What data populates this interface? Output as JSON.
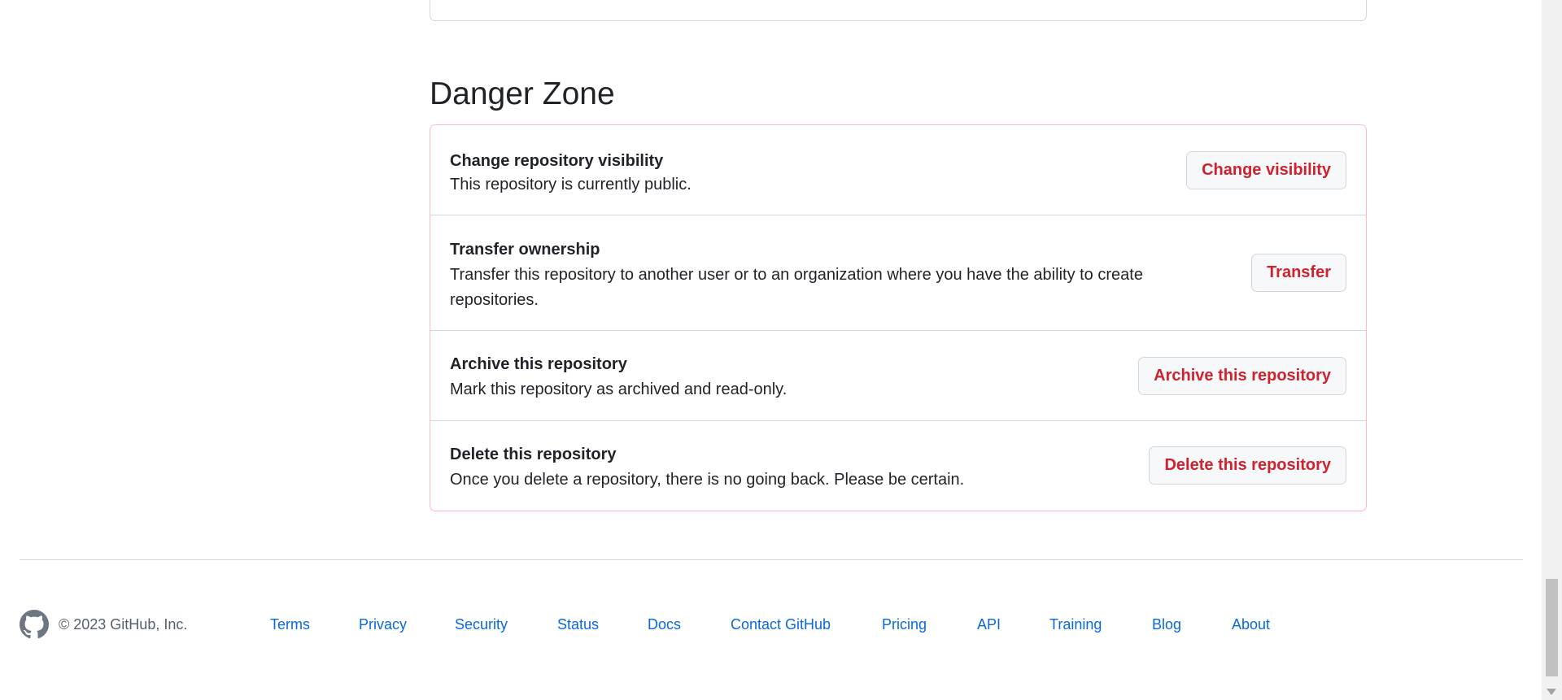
{
  "danger_zone": {
    "title": "Danger Zone",
    "rows": [
      {
        "title": "Change repository visibility",
        "description": "This repository is currently public.",
        "button": "Change visibility"
      },
      {
        "title": "Transfer ownership",
        "description": "Transfer this repository to another user or to an organization where you have the ability to create repositories.",
        "button": "Transfer"
      },
      {
        "title": "Archive this repository",
        "description": "Mark this repository as archived and read-only.",
        "button": "Archive this repository"
      },
      {
        "title": "Delete this repository",
        "description": "Once you delete a repository, there is no going back. Please be certain.",
        "button": "Delete this repository"
      }
    ]
  },
  "footer": {
    "logo_icon": "github-mark-icon",
    "copyright": "© 2023 GitHub, Inc.",
    "links": [
      "Terms",
      "Privacy",
      "Security",
      "Status",
      "Docs",
      "Contact GitHub",
      "Pricing",
      "API",
      "Training",
      "Blog",
      "About"
    ]
  },
  "colors": {
    "danger_text": "#cf222e",
    "danger_border": "#ffb8c0",
    "link": "#0969da",
    "muted": "#57606a"
  }
}
